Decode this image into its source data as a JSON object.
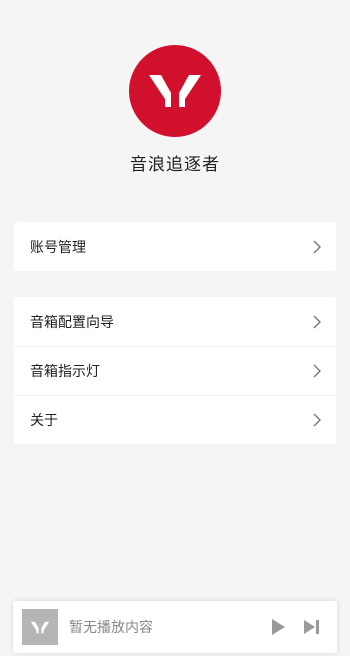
{
  "profile": {
    "name": "音浪追逐者",
    "logo_icon": "y-brand-logo-icon",
    "logo_color": "#d0102d"
  },
  "menu_account": [
    {
      "label": "账号管理",
      "icon": "chevron-right-icon"
    }
  ],
  "menu_settings": [
    {
      "label": "音箱配置向导",
      "icon": "chevron-right-icon"
    },
    {
      "label": "音箱指示灯",
      "icon": "chevron-right-icon"
    },
    {
      "label": "关于",
      "icon": "chevron-right-icon"
    }
  ],
  "player": {
    "status_text": "暂无播放内容",
    "thumb_icon": "y-brand-logo-icon",
    "play_icon": "play-icon",
    "next_icon": "skip-next-icon"
  }
}
